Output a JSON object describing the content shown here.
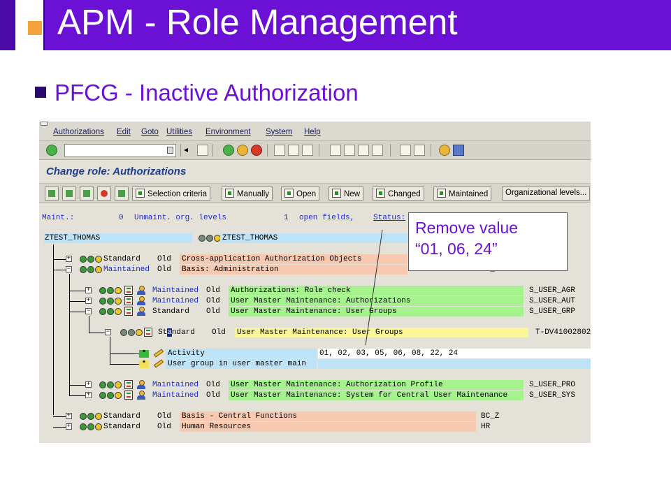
{
  "slide": {
    "title": "APM - Role Management",
    "subtitle": "PFCG - Inactive Authorization"
  },
  "menu": [
    "Authorizations",
    "Edit",
    "Goto",
    "Utilities",
    "Environment",
    "System",
    "Help"
  ],
  "screen_title": "Change role: Authorizations",
  "app_buttons": {
    "selection_criteria": "Selection criteria",
    "manually": "Manually",
    "open": "Open",
    "new": "New",
    "changed": "Changed",
    "maintained": "Maintained",
    "org_levels": "Organizational levels..."
  },
  "status_line": {
    "maint_label": "Maint.:",
    "maint_value": "0",
    "unmaint_label": "Unmaint. org. levels",
    "open_value": "1",
    "open_label": "open fields,",
    "status_label": "Status:"
  },
  "root": {
    "left": "ZTEST_THOMAS",
    "right": "ZTEST_THOMAS"
  },
  "tree": {
    "row1": {
      "status": "Standard",
      "old": "Old",
      "text": "Cross-application Authorization Objects"
    },
    "row2": {
      "status": "Maintained",
      "old": "Old",
      "text": "Basis: Administration",
      "code": "BC_A"
    },
    "row3": {
      "status": "Maintained",
      "old": "Old",
      "text": "Authorizations: Role check",
      "code": "S_USER_AGR"
    },
    "row4": {
      "status": "Maintained",
      "old": "Old",
      "text": "User Master Maintenance: Authorizations",
      "code": "S_USER_AUT"
    },
    "row5": {
      "status": "Standard",
      "old": "Old",
      "text": "User Master Maintenance: User Groups",
      "code": "S_USER_GRP"
    },
    "row6": {
      "status_pre": "St",
      "status_cursor": "a",
      "status_post": "ndard",
      "old": "Old",
      "text": "User Master Maintenance: User Groups",
      "code": "T-DV41002802"
    },
    "row7": {
      "marker": "*",
      "text": "Activity",
      "value": "01, 02, 03, 05, 06, 08, 22, 24"
    },
    "row8": {
      "marker": "*",
      "text": "User group in user master main"
    },
    "row9": {
      "status": "Maintained",
      "old": "Old",
      "text": "User Master Maintenance: Authorization Profile",
      "code": "S_USER_PRO"
    },
    "row10": {
      "status": "Maintained",
      "old": "Old",
      "text": "User Master Maintenance: System for Central User Maintenance",
      "code": "S_USER_SYS"
    },
    "row11": {
      "status": "Standard",
      "old": "Old",
      "text": "Basis - Central Functions",
      "code": "BC_Z"
    },
    "row12": {
      "status": "Standard",
      "old": "Old",
      "text": "Human Resources",
      "code": "HR"
    }
  },
  "callout": {
    "line1": "Remove value",
    "line2": "“01, 06, 24”"
  },
  "colors": {
    "title_bar": "#6b11d6",
    "accent_orange": "#f5a23a",
    "link_blue": "#1a2ad0"
  }
}
